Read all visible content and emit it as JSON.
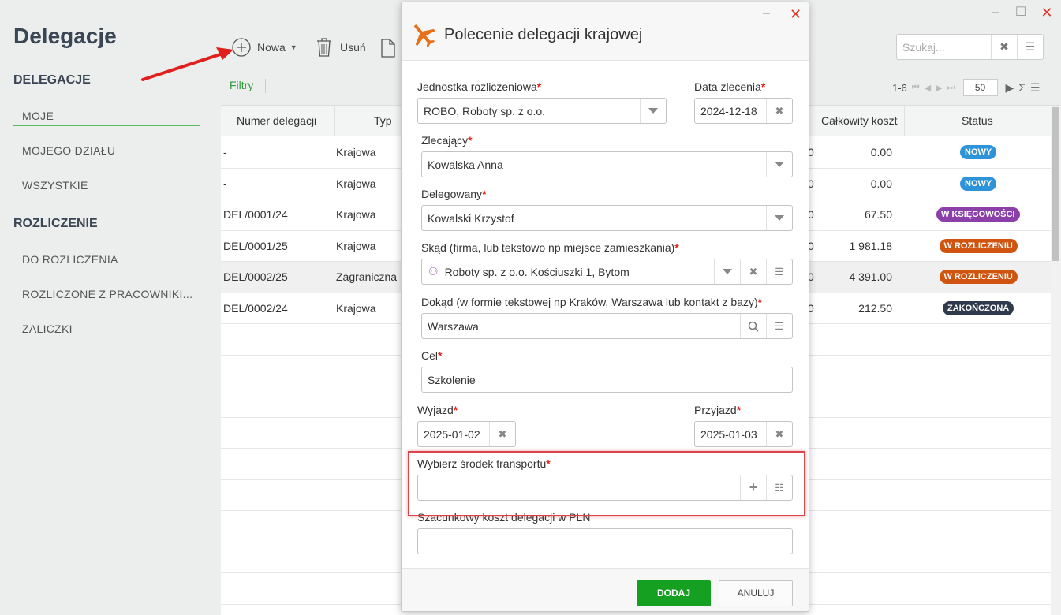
{
  "window": {
    "minimize": "–",
    "maximize": "☐",
    "close": "✕"
  },
  "app": {
    "title": "Delegacje"
  },
  "sidebar": {
    "sections": [
      {
        "title": "DELEGACJE",
        "items": [
          "MOJE",
          "MOJEGO DZIAŁU",
          "WSZYSTKIE"
        ]
      },
      {
        "title": "ROZLICZENIE",
        "items": [
          "DO ROZLICZENIA",
          "ROZLICZONE Z PRACOWNIKI...",
          "ZALICZKI"
        ]
      }
    ],
    "active_item": "MOJE"
  },
  "toolbar": {
    "new_label": "Nowa",
    "delete_label": "Usuń",
    "filters_label": "Filtry"
  },
  "search": {
    "placeholder": "Szukaj..."
  },
  "pager": {
    "range": "1-6",
    "page_size": "50"
  },
  "table": {
    "headers": {
      "number": "Numer delegacji",
      "type": "Typ",
      "total": "Całkowity koszt",
      "status": "Status"
    },
    "rows": [
      {
        "number": "-",
        "type": "Krajowa",
        "partial": "0",
        "total": "0.00",
        "status": "NOWY"
      },
      {
        "number": "-",
        "type": "Krajowa",
        "partial": "0",
        "total": "0.00",
        "status": "NOWY"
      },
      {
        "number": "DEL/0001/24",
        "type": "Krajowa",
        "partial": "0",
        "total": "67.50",
        "status": "W KSIĘGOWOŚCI"
      },
      {
        "number": "DEL/0001/25",
        "type": "Krajowa",
        "partial": "0",
        "total": "1 981.18",
        "status": "W ROZLICZENIU"
      },
      {
        "number": "DEL/0002/25",
        "type": "Zagraniczna",
        "partial": "0",
        "total": "4 391.00",
        "status": "W ROZLICZENIU"
      },
      {
        "number": "DEL/0002/24",
        "type": "Krajowa",
        "partial": "0",
        "total": "212.50",
        "status": "ZAKOŃCZONA"
      }
    ],
    "status_colors": {
      "NOWY": "#2e93d8",
      "W KSIĘGOWOŚCI": "#8b3fa8",
      "W ROZLICZENIU": "#d0540f",
      "ZAKOŃCZONA": "#2f3a4c"
    }
  },
  "modal": {
    "title": "Polecenie delegacji krajowej",
    "fields": {
      "unit": {
        "label": "Jednostka rozliczeniowa",
        "value": "ROBO, Roboty sp. z o.o."
      },
      "order_date": {
        "label": "Data zlecenia",
        "value": "2024-12-18"
      },
      "orderer": {
        "label": "Zlecający",
        "value": "Kowalska Anna"
      },
      "delegate": {
        "label": "Delegowany",
        "value": "Kowalski Krzystof"
      },
      "from": {
        "label": "Skąd (firma, lub tekstowo np miejsce zamieszkania)",
        "value": "Roboty sp. z o.o. Kościuszki 1, Bytom"
      },
      "to": {
        "label": "Dokąd (w formie tekstowej np Kraków, Warszawa lub kontakt z bazy)",
        "value": "Warszawa"
      },
      "purpose": {
        "label": "Cel",
        "value": "Szkolenie"
      },
      "departure": {
        "label": "Wyjazd",
        "value": "2025-01-02"
      },
      "arrival": {
        "label": "Przyjazd",
        "value": "2025-01-03"
      },
      "transport": {
        "label": "Wybierz środek transportu",
        "value": ""
      },
      "estimated_cost": {
        "label": "Szacunkowy koszt delegacji w PLN",
        "value": ""
      }
    },
    "required_mark": "*",
    "buttons": {
      "add": "DODAJ",
      "cancel": "ANULUJ"
    }
  },
  "colors": {
    "accent_green": "#16a021",
    "required_red": "#d9281e",
    "plane_orange": "#e8701a",
    "highlight_red": "#d9464a"
  }
}
